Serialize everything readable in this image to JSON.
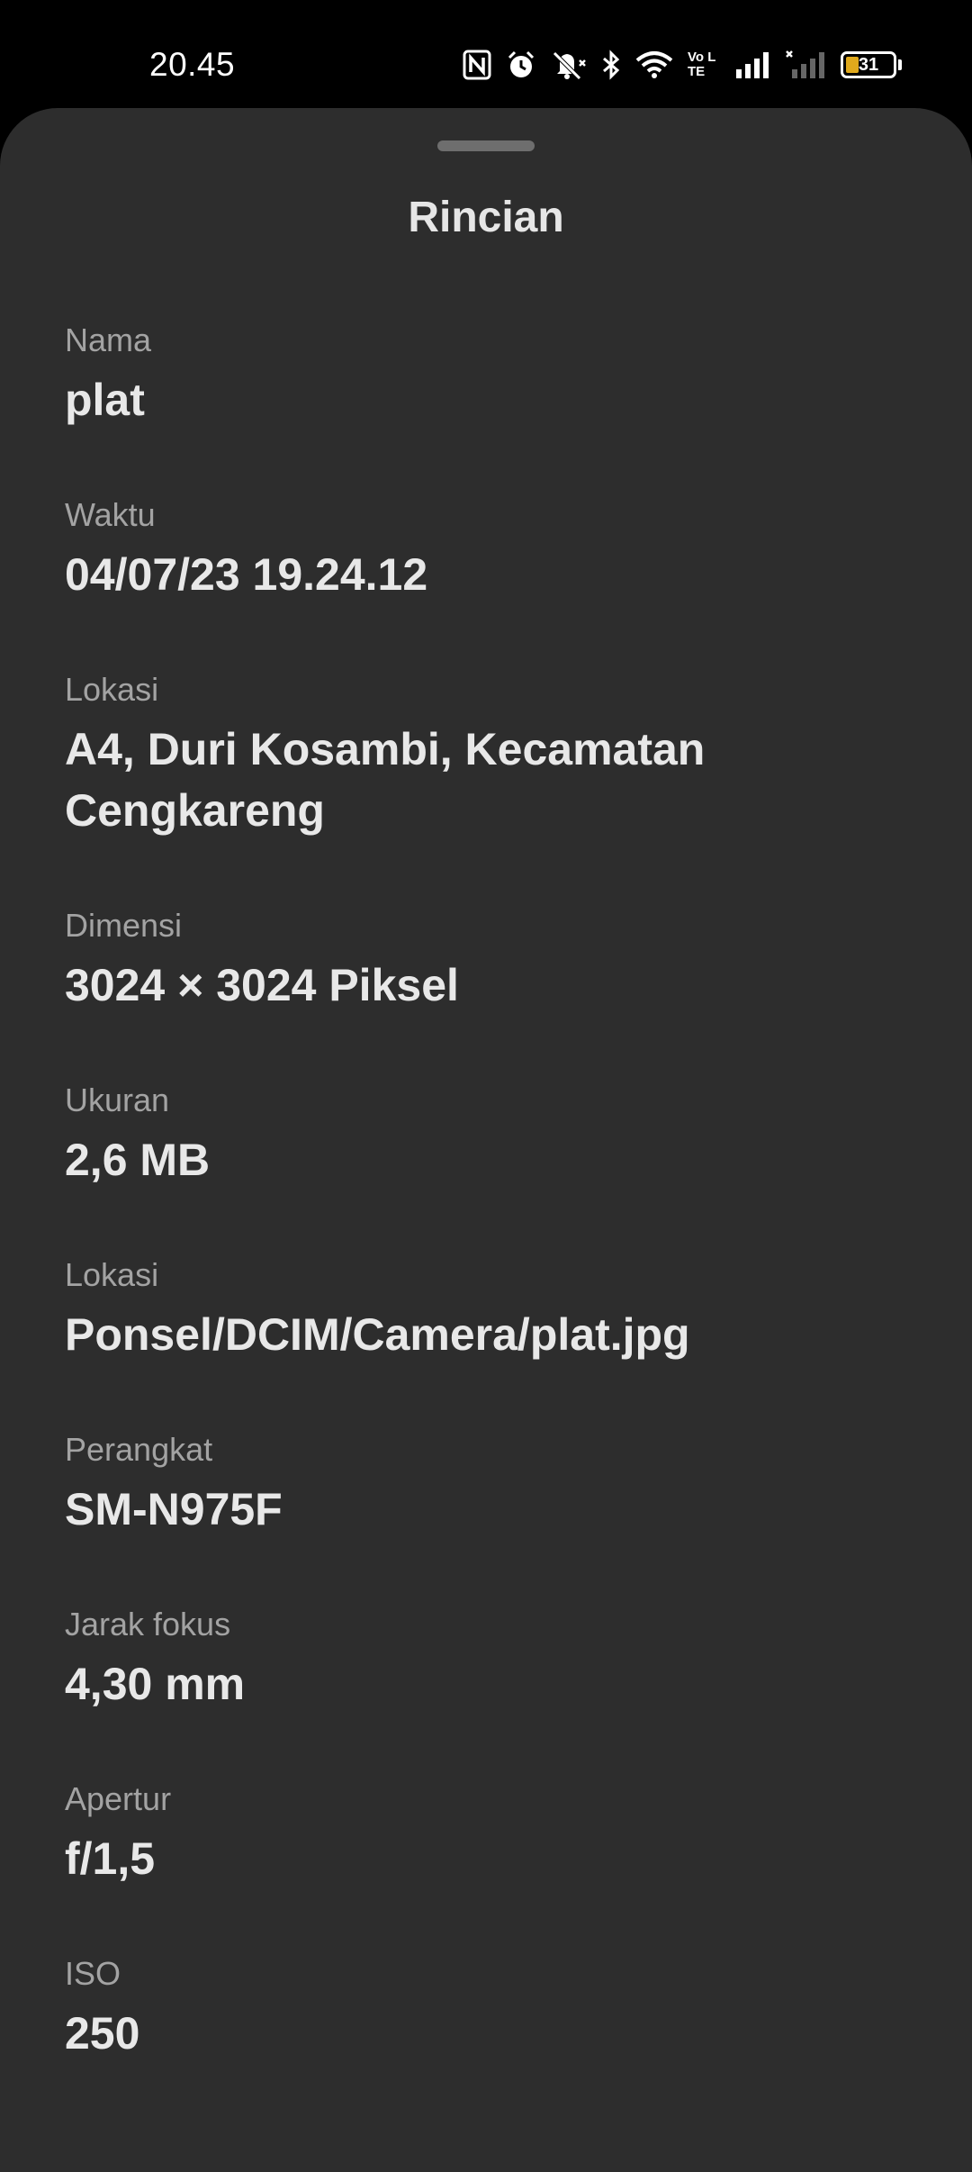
{
  "status_bar": {
    "time": "20.45",
    "icons": [
      "nfc-icon",
      "alarm-icon",
      "mute-icon",
      "bluetooth-icon",
      "wifi-icon",
      "volte-icon",
      "signal-icon",
      "signal-no-service-icon",
      "battery-icon"
    ],
    "volte_text": "Vo LTE",
    "battery_level": "31",
    "battery_color": "#e0a91c"
  },
  "sheet": {
    "title": "Rincian",
    "details": [
      {
        "label": "Nama",
        "value": "plat"
      },
      {
        "label": "Waktu",
        "value": "04/07/23 19.24.12"
      },
      {
        "label": "Lokasi",
        "value": "A4, Duri Kosambi, Kecamatan Cengkareng"
      },
      {
        "label": "Dimensi",
        "value": "3024 × 3024 Piksel"
      },
      {
        "label": "Ukuran",
        "value": "2,6 MB"
      },
      {
        "label": "Lokasi",
        "value": "Ponsel/DCIM/Camera/plat.jpg"
      },
      {
        "label": "Perangkat",
        "value": "SM-N975F"
      },
      {
        "label": "Jarak fokus",
        "value": "4,30 mm"
      },
      {
        "label": "Apertur",
        "value": "f/1,5"
      },
      {
        "label": "ISO",
        "value": "250"
      }
    ]
  },
  "colors": {
    "background": "#000000",
    "sheet": "#2d2d2d",
    "label": "#a3a3a3",
    "value": "#e8e8e8"
  }
}
